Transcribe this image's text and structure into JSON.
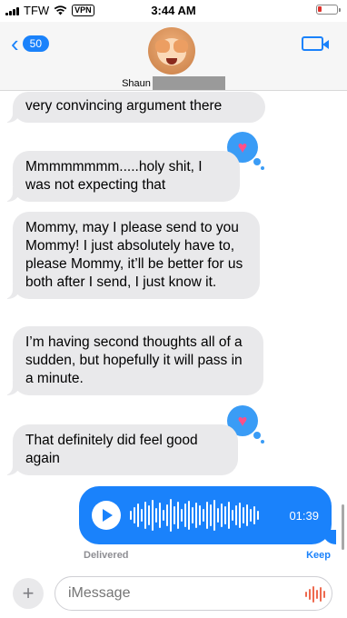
{
  "status_bar": {
    "carrier": "TFW",
    "vpn": "VPN",
    "time": "3:44 AM"
  },
  "header": {
    "back_count": "50",
    "contact_name": "Shaun",
    "accent_color": "#1a82fb"
  },
  "messages": [
    {
      "text": "very convincing argument there",
      "tapback": null
    },
    {
      "text": "Mmmmmmmm.....holy shit, I was not expecting that",
      "tapback": "heart"
    },
    {
      "text": "Mommy, may I please send to you Mommy! I just absolutely have to, please Mommy, it’ll be better for us both after I send, I just know it.",
      "tapback": null
    },
    {
      "text": "I’m having second thoughts all of a sudden, but hopefully it will pass in a minute.",
      "tapback": null
    },
    {
      "text": "That definitely did feel good again",
      "tapback": "heart"
    }
  ],
  "audio_message": {
    "duration": "01:39",
    "status": "Delivered",
    "keep_label": "Keep"
  },
  "composer": {
    "placeholder": "iMessage"
  }
}
